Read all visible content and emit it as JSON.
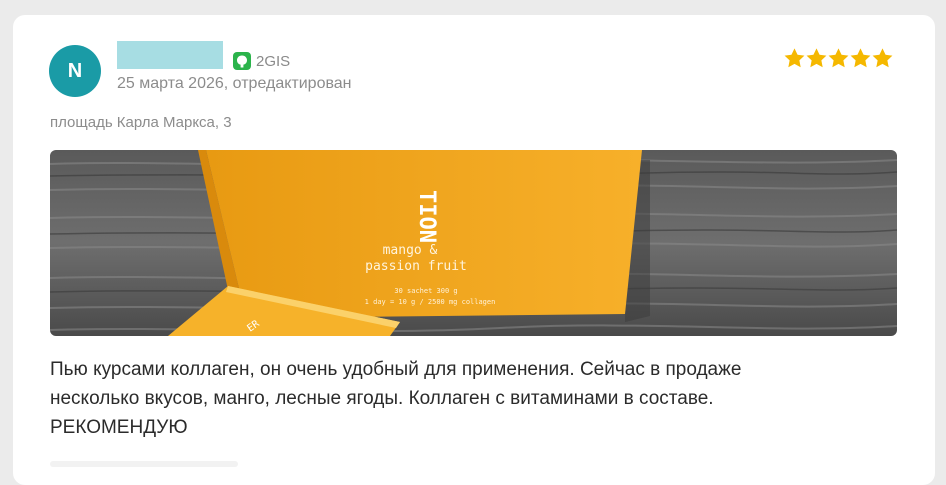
{
  "review": {
    "author_initial": "N",
    "source_label": "2GIS",
    "date_line": "25 марта 2026, отредактирован",
    "rating": 5,
    "address": "площадь Карла Маркса, 3",
    "text": "Пью курсами коллаген, он очень удобный для применения. Сейчас в продаже\nнесколько вкусов, манго, лесные ягоды. Коллаген с витаминами в составе.\nРЕКОМЕНДУЮ"
  },
  "photo": {
    "box_brand_fragment": "TION",
    "box_flavor_line1": "mango &",
    "box_flavor_line2": "passion fruit",
    "box_small_line1": "30 sachet 300 g",
    "box_small_line2": "1 day = 10 g / 2500 mg collagen",
    "sachet_fragment": "ER"
  },
  "colors": {
    "avatar": "#1a9ba6",
    "star": "#f5b800",
    "source_badge": "#2bb34b",
    "box": "#f3a71f"
  }
}
